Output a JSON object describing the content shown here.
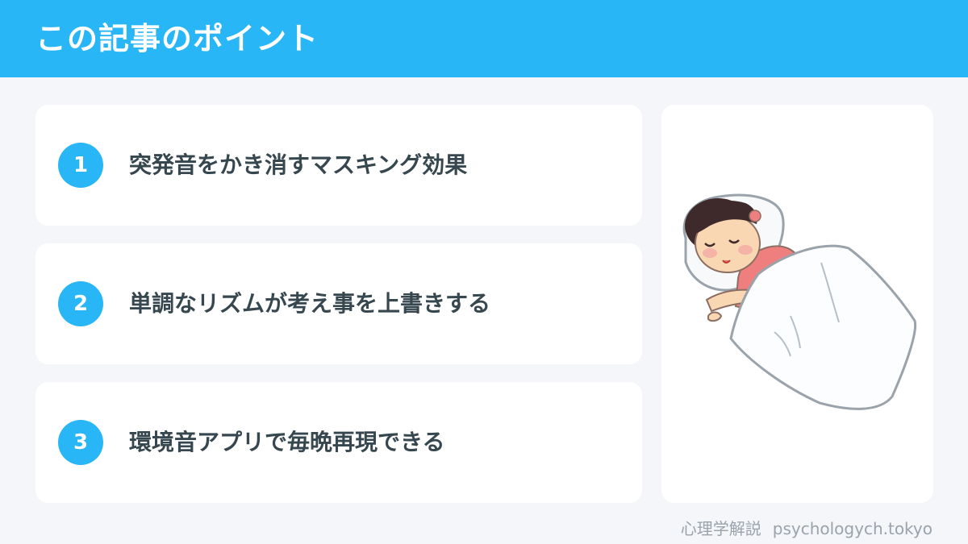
{
  "header": {
    "title": "この記事のポイント"
  },
  "points": [
    {
      "number": "1",
      "text": "突発音をかき消すマスキング効果"
    },
    {
      "number": "2",
      "text": "単調なリズムが考え事を上書きする"
    },
    {
      "number": "3",
      "text": "環境音アプリで毎晩再現できる"
    }
  ],
  "illustration": {
    "icon": "sleeping-girl-illustration"
  },
  "footer": {
    "site_name": "心理学解説",
    "domain": "psychologych.tokyo"
  },
  "colors": {
    "accent": "#29b6f6",
    "background": "#f4f6f9",
    "text": "#37474f",
    "footer_text": "#9aa3ab"
  }
}
